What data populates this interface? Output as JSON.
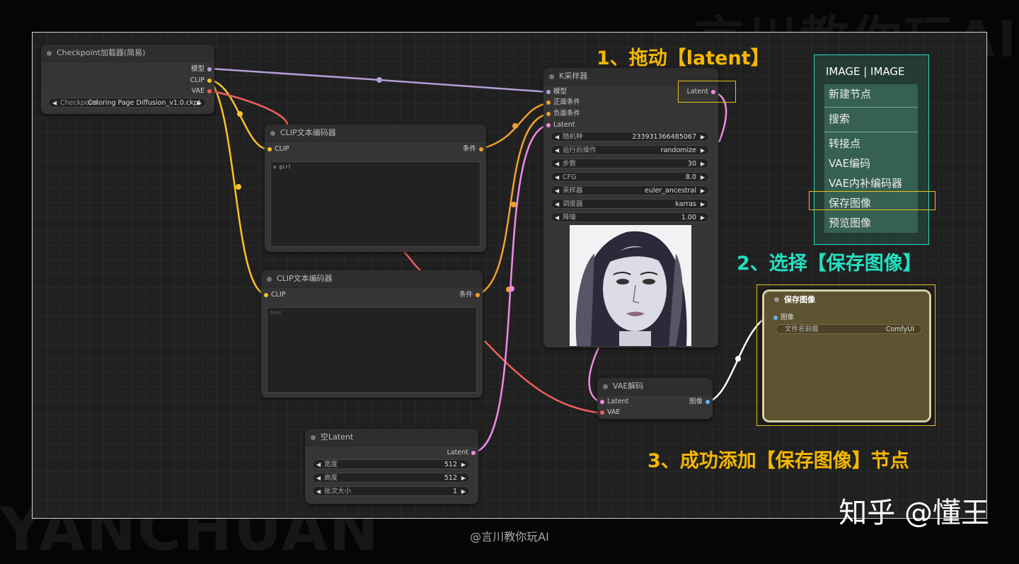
{
  "watermark": {
    "top": "言川教你玩AI",
    "bottom": "YANCHUAN",
    "credit": "@言川教你玩AI",
    "zhihu": "知乎 @懂王"
  },
  "colors": {
    "model": "#b39ddb",
    "clip": "#f7c325",
    "vae": "#f0605a",
    "cond": "#f0a030",
    "latent": "#f08ae8",
    "image": "#64b5f6",
    "annotation_yellow": "#f5b800",
    "annotation_cyan": "#22e0c0"
  },
  "annotations": {
    "step1": "1、拖动【latent】",
    "step2": "2、选择【保存图像】",
    "step3": "3、成功添加【保存图像】节点"
  },
  "checkpoint_node": {
    "title": "Checkpoint加载器(简易)",
    "outputs": [
      "模型",
      "CLIP",
      "VAE"
    ],
    "ckpt_label": "Checkpoint",
    "ckpt_value": "Coloring Page Diffusion_v1.0.ckpt"
  },
  "clip_node_1": {
    "title": "CLIP文本编码器",
    "input": "CLIP",
    "output": "条件",
    "text": "a girl"
  },
  "clip_node_2": {
    "title": "CLIP文本编码器",
    "input": "CLIP",
    "output": "条件",
    "text": "text"
  },
  "ksampler": {
    "title": "K采样器",
    "inputs": [
      "模型",
      "正面条件",
      "负面条件",
      "Latent"
    ],
    "output": "Latent",
    "widgets": [
      {
        "label": "随机种",
        "value": "233931366485067"
      },
      {
        "label": "运行后操作",
        "value": "randomize"
      },
      {
        "label": "步数",
        "value": "30"
      },
      {
        "label": "CFG",
        "value": "8.0"
      },
      {
        "label": "采样器",
        "value": "euler_ancestral"
      },
      {
        "label": "调度器",
        "value": "karras"
      },
      {
        "label": "降噪",
        "value": "1.00"
      }
    ]
  },
  "empty_latent": {
    "title": "空Latent",
    "output": "Latent",
    "widgets": [
      {
        "label": "宽度",
        "value": "512"
      },
      {
        "label": "高度",
        "value": "512"
      },
      {
        "label": "批次大小",
        "value": "1"
      }
    ]
  },
  "vae_decode": {
    "title": "VAE解码",
    "inputs": [
      "Latent",
      "VAE"
    ],
    "output": "图像"
  },
  "context_menu": {
    "title": "IMAGE | IMAGE",
    "items": [
      "新建节点",
      "搜索",
      "转接点",
      "VAE编码",
      "VAE内补编码器",
      "保存图像",
      "预览图像"
    ],
    "selected": "保存图像"
  },
  "save_image_node": {
    "title": "保存图像",
    "input": "图像",
    "widget_label": "文件名前缀",
    "widget_value": "ComfyUI"
  }
}
